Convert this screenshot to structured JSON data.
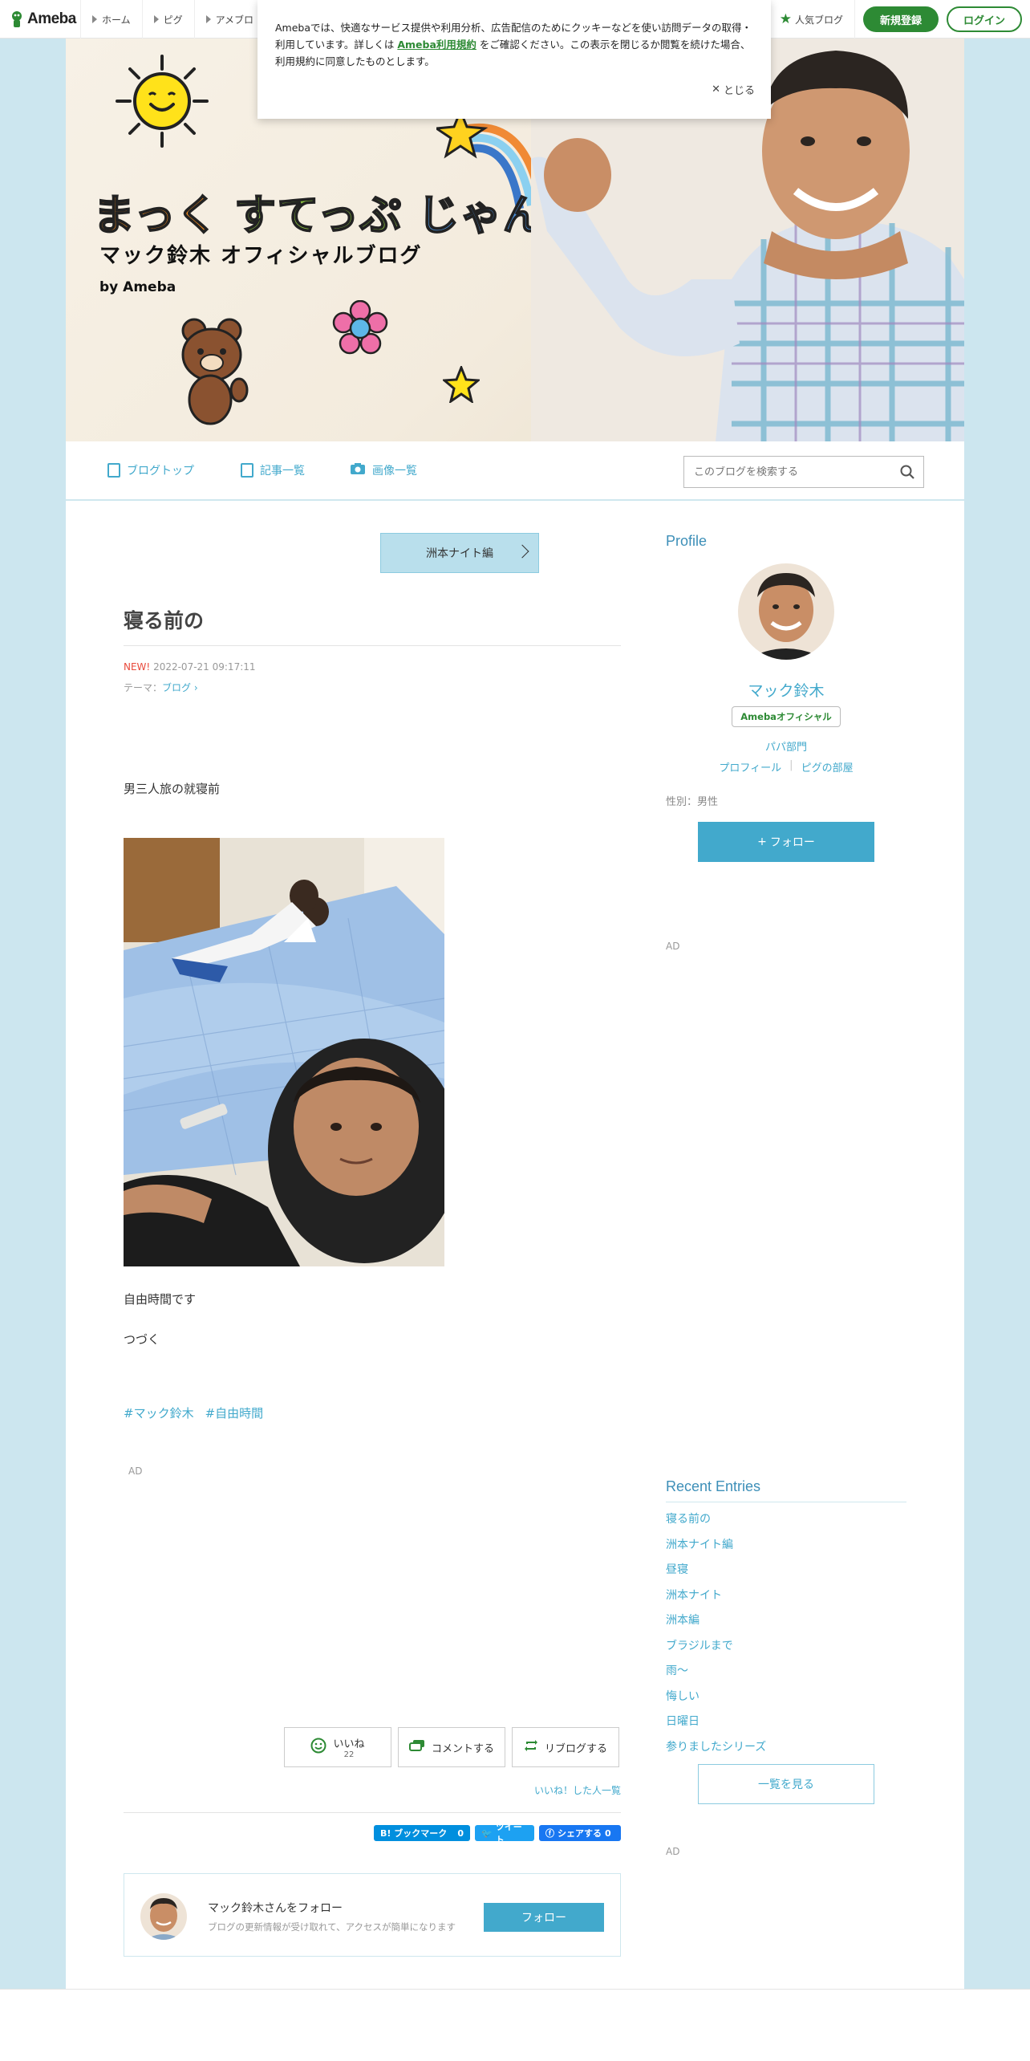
{
  "global_nav": {
    "logo_text": "Ameba",
    "items": [
      "ホーム",
      "ピグ",
      "アメブロ"
    ],
    "popular_blogs": "人気ブログ",
    "register": "新規登録",
    "login": "ログイン"
  },
  "cookie_notice": {
    "text_before": "Amebaでは、快適なサービス提供や利用分析、広告配信のためにクッキーなどを使い訪問データの取得・利用しています。詳しくは ",
    "link_text": "Ameba利用規約",
    "text_after": " をご確認ください。この表示を閉じるか閲覧を続けた場合、利用規約に同意したものとします。",
    "close_label": "とじる"
  },
  "banner": {
    "title_part1": "まっく",
    "title_part2": "すてっぷ",
    "title_part3": "じゃんぷ",
    "blog_name": "マック鈴木 オフィシャルブログ",
    "by_ameba": "by Ameba"
  },
  "blog_nav": {
    "items": [
      "ブログトップ",
      "記事一覧",
      "画像一覧"
    ],
    "search_placeholder": "このブログを検索する"
  },
  "entry": {
    "theme_tag": "洲本ナイト編",
    "title": "寝る前の",
    "new_label": "NEW!",
    "date": "2022-07-21 09:17:11",
    "theme_prefix": "テーマ：",
    "theme_name": "ブログ",
    "paragraph1": "男三人旅の就寝前",
    "paragraph2": "自由時間です",
    "paragraph3": "つづく",
    "hashtags": [
      "#マック鈴木",
      "#自由時間"
    ],
    "ad_label": "AD",
    "like_label": "いいね",
    "like_count": "22",
    "comment_label": "コメントする",
    "reblog_label": "リブログする",
    "liked_list": "いいね！した人一覧",
    "share_hatena": "B! ブックマーク",
    "share_hatena_count": "0",
    "share_tweet": "ツイート",
    "share_fb": "シェアする",
    "share_fb_count": "0",
    "follow_name": "マック鈴木さんをフォロー",
    "follow_desc": "ブログの更新情報が受け取れて、アクセスが簡単になります",
    "follow_button": "フォロー"
  },
  "sidebar": {
    "profile_heading": "Profile",
    "name": "マック鈴木",
    "badge": "Amebaオフィシャル",
    "genre": "パパ部門",
    "links": [
      "プロフィール",
      "ピグの部屋"
    ],
    "gender": "性別：男性",
    "follow_button": "フォロー",
    "ad_label_1": "AD",
    "recent_heading": "Recent Entries",
    "recent_entries": [
      "寝る前の",
      "洲本ナイト編",
      "昼寝",
      "洲本ナイト",
      "洲本編",
      "ブラジルまで",
      "雨〜",
      "悔しい",
      "日曜日",
      "参りましたシリーズ"
    ],
    "see_all": "一覧を見る",
    "ad_label_2": "AD"
  },
  "colors": {
    "accent_blue": "#42a9cc",
    "ameba_green": "#2d8a34",
    "page_bg": "#cce6ef"
  }
}
